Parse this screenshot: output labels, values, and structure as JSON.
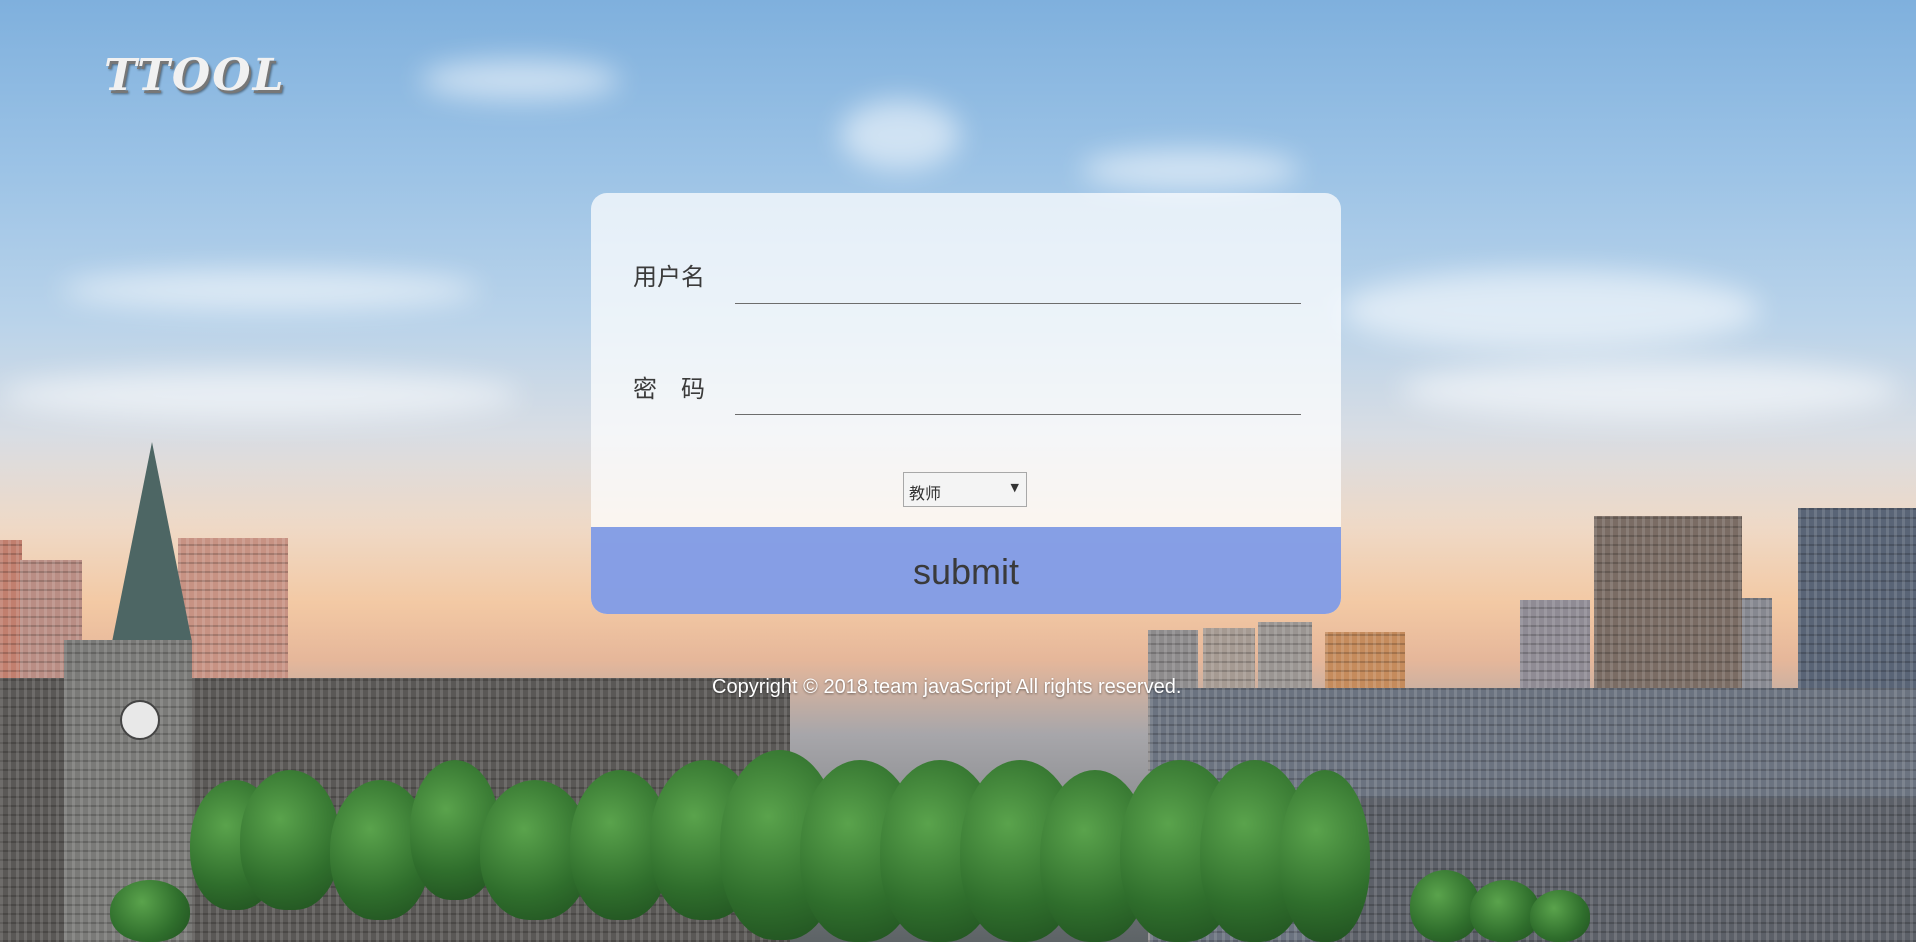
{
  "logo": {
    "text": "TTOOL"
  },
  "login": {
    "username_label": "用户名",
    "username_value": "",
    "password_label": "密　码",
    "password_value": "",
    "role_select": {
      "selected": "教师"
    },
    "submit_label": "submit"
  },
  "footer": {
    "copyright": "Copyright © 2018.team javaScript All rights reserved."
  },
  "colors": {
    "submit_bar": "#7c97e4",
    "card_bg": "#ffffffb8",
    "text": "#3b3b3b"
  },
  "icons": {
    "select_arrow": "dropdown-arrow-icon"
  }
}
